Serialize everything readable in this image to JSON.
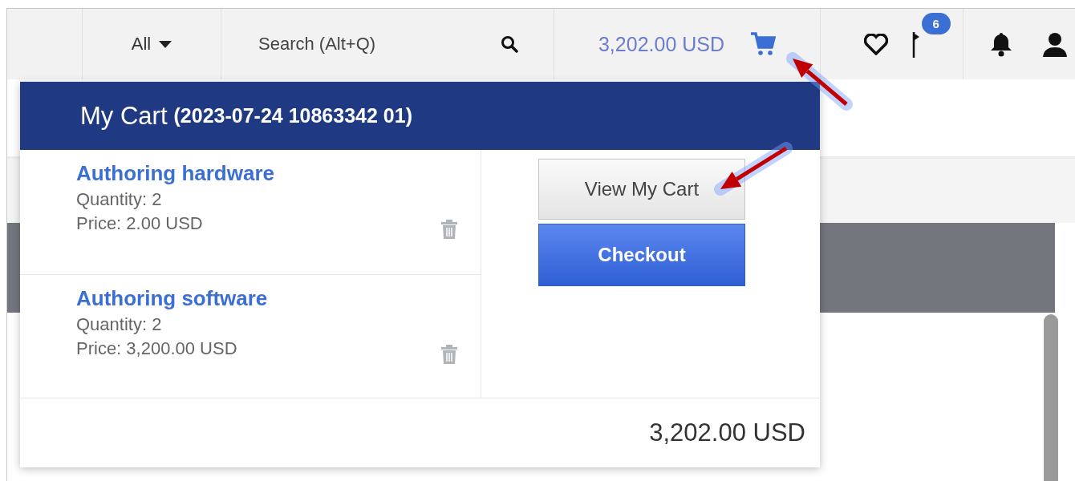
{
  "topbar": {
    "scope": {
      "label": "All"
    },
    "search": {
      "placeholder": "Search (Alt+Q)"
    },
    "cart_total": "3,202.00 USD",
    "notifications_badge": "6"
  },
  "cart": {
    "title": "My Cart",
    "order_ref": "(2023-07-24 10863342 01)",
    "items": [
      {
        "name": "Authoring hardware",
        "quantity": "Quantity: 2",
        "price": "Price: 2.00 USD"
      },
      {
        "name": "Authoring software",
        "quantity": "Quantity: 2",
        "price": "Price: 3,200.00 USD"
      }
    ],
    "buttons": [
      {
        "label": "View My Cart",
        "kind": "secondary"
      },
      {
        "label": "Checkout",
        "kind": "primary"
      }
    ],
    "total": "3,202.00 USD"
  }
}
